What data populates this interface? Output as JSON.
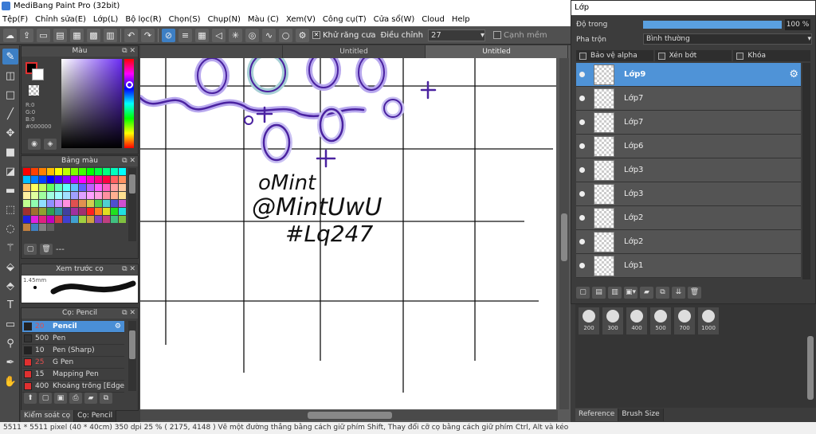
{
  "app": {
    "title": "MediBang Paint Pro (32bit)"
  },
  "menu": [
    "Tệp(F)",
    "Chỉnh sửa(E)",
    "Lớp(L)",
    "Bộ lọc(R)",
    "Chọn(S)",
    "Chụp(N)",
    "Màu (C)",
    "Xem(V)",
    "Công cụ(T)",
    "Cửa sổ(W)",
    "Cloud",
    "Help"
  ],
  "toolbar": {
    "antialias_label": "Khử răng cưa",
    "correction_label": "Điều chỉnh",
    "correction_value": "27",
    "edge_label": "Cạnh mềm"
  },
  "color_panel": {
    "title": "Màu",
    "r": "R:0",
    "g": "G:0",
    "b": "B:0",
    "hex": "#000000",
    "fg_color": "#000000",
    "bg_color": "#ffffff"
  },
  "swatch_panel": {
    "title": "Bảng màu",
    "footer": "---",
    "colors": [
      "#ff0000",
      "#ff4000",
      "#ff8000",
      "#ffbf00",
      "#ffff00",
      "#bfff00",
      "#80ff00",
      "#40ff00",
      "#00ff00",
      "#00ff40",
      "#00ff80",
      "#00ffbf",
      "#00ffff",
      "#00bfff",
      "#0080ff",
      "#0040ff",
      "#0000ff",
      "#4000ff",
      "#8000ff",
      "#bf00ff",
      "#ff00ff",
      "#ff00bf",
      "#ff0080",
      "#ff0040",
      "#ff6060",
      "#ff9060",
      "#ffc060",
      "#ffff60",
      "#c0ff60",
      "#60ff60",
      "#60ffc0",
      "#60ffff",
      "#60c0ff",
      "#6060ff",
      "#c060ff",
      "#ff60ff",
      "#ff60c0",
      "#ffa0a0",
      "#ffc8a0",
      "#fff0a0",
      "#e0ffa0",
      "#a0ffa0",
      "#a0ffe0",
      "#a0ffff",
      "#a0e0ff",
      "#a0a0ff",
      "#e0a0ff",
      "#ffa0ff",
      "#ffa0e0",
      "#ff90a0",
      "#ffb090",
      "#ffe090",
      "#c0ff90",
      "#90ffb0",
      "#90e0ff",
      "#9090ff",
      "#d090ff",
      "#ff90e0",
      "#e05050",
      "#e09050",
      "#d0d050",
      "#50d050",
      "#50d0d0",
      "#5050d0",
      "#d050d0",
      "#a03030",
      "#a07030",
      "#90a030",
      "#30a050",
      "#3090a0",
      "#4040a0",
      "#a030a0",
      "#a03070",
      "#ff2020",
      "#ff8020",
      "#e0e020",
      "#20e020",
      "#20e0e0",
      "#2020e0",
      "#e020e0",
      "#e02080",
      "#c000c0",
      "#d04040",
      "#4040d0",
      "#40a0d0",
      "#a0d040",
      "#d0a040",
      "#8040c0",
      "#c04080",
      "#40c080",
      "#80c040",
      "#c08040",
      "#4080c0",
      "#808080",
      "#606060",
      "#404040"
    ]
  },
  "preview_panel": {
    "title": "Xem trước cọ",
    "size": "1.45mm"
  },
  "brush_panel": {
    "title": "Cọ: Pencil",
    "items": [
      {
        "size": "20",
        "name": "Pencil",
        "color": "#222222"
      },
      {
        "size": "500",
        "name": "Pen",
        "color": "#333333"
      },
      {
        "size": "10",
        "name": "Pen (Sharp)",
        "color": "#222222"
      },
      {
        "size": "25",
        "name": "G Pen",
        "color": "#e03030"
      },
      {
        "size": "15",
        "name": "Mapping Pen",
        "color": "#e03030"
      },
      {
        "size": "400",
        "name": "Khoảng trống [Edge ]",
        "color": "#e03030"
      }
    ]
  },
  "left_tabs": [
    "Kiểm soát cọ",
    "Cọ: Pencil"
  ],
  "documents": [
    "",
    "Untitled",
    "Untitled"
  ],
  "drawing": {
    "line1": "oMint",
    "line2": "@MintUwU",
    "line3": "#Lq247"
  },
  "layer_window": {
    "title": "Lớp",
    "opacity_label": "Độ trong",
    "opacity_value": "100 %",
    "opacity": 1.0,
    "blend_label": "Pha trộn",
    "blend_value": "Bình thường",
    "protect_alpha": "Bảo vệ alpha",
    "clipping": "Xén bớt",
    "lock": "Khóa",
    "layers": [
      "Lớp9",
      "Lớp7",
      "Lớp7",
      "Lớp6",
      "Lớp3",
      "Lớp3",
      "Lớp2",
      "Lớp2",
      "Lớp1"
    ]
  },
  "brush_sizes": [
    "200",
    "300",
    "400",
    "500",
    "700",
    "1000"
  ],
  "right_tabs": [
    "Reference",
    "Brush Size"
  ],
  "status": "5511 * 5511 pixel  (40 * 40cm)  350 dpi  25 %  ( 2175, 4148 )  Vẽ một đường thẳng bằng cách giữ phím Shift, Thay đổi cỡ cọ bằng cách giữ phím Ctrl, Alt và kéo"
}
